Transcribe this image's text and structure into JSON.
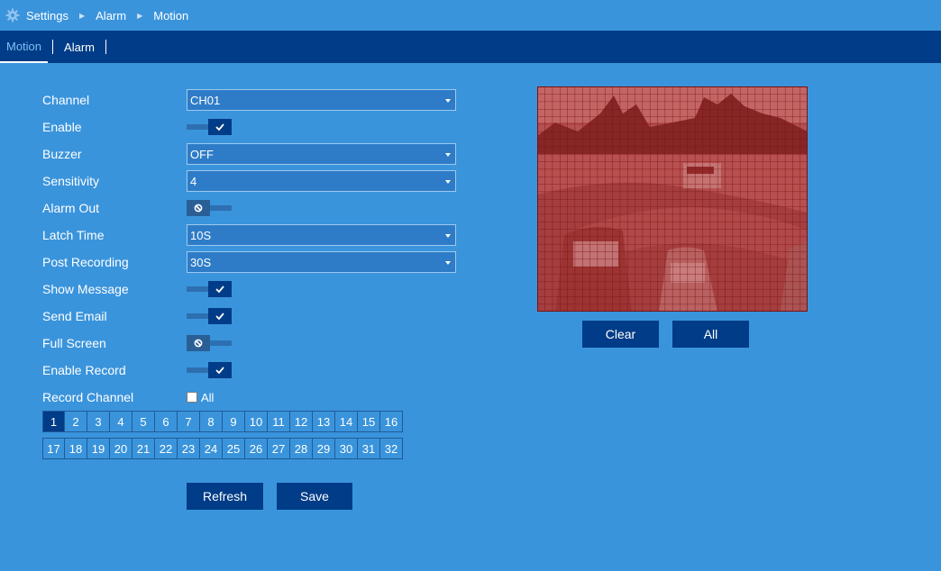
{
  "breadcrumb": [
    "Settings",
    "Alarm",
    "Motion"
  ],
  "tabs": [
    {
      "label": "Motion",
      "active": true
    },
    {
      "label": "Alarm",
      "active": false
    }
  ],
  "fields": {
    "channel": {
      "label": "Channel",
      "value": "CH01"
    },
    "enable": {
      "label": "Enable",
      "on": true
    },
    "buzzer": {
      "label": "Buzzer",
      "value": "OFF"
    },
    "sensitivity": {
      "label": "Sensitivity",
      "value": "4"
    },
    "alarm_out": {
      "label": "Alarm Out",
      "on": false
    },
    "latch_time": {
      "label": "Latch Time",
      "value": "10S"
    },
    "post_recording": {
      "label": "Post Recording",
      "value": "30S"
    },
    "show_message": {
      "label": "Show Message",
      "on": true
    },
    "send_email": {
      "label": "Send Email",
      "on": true
    },
    "full_screen": {
      "label": "Full Screen",
      "on": false
    },
    "enable_record": {
      "label": "Enable Record",
      "on": true
    },
    "record_channel": {
      "label": "Record Channel",
      "all_label": "All",
      "all_checked": false
    }
  },
  "channels_row1": [
    "1",
    "2",
    "3",
    "4",
    "5",
    "6",
    "7",
    "8",
    "9",
    "10",
    "11",
    "12",
    "13",
    "14",
    "15",
    "16"
  ],
  "channels_row2": [
    "17",
    "18",
    "19",
    "20",
    "21",
    "22",
    "23",
    "24",
    "25",
    "26",
    "27",
    "28",
    "29",
    "30",
    "31",
    "32"
  ],
  "selected_channel": "1",
  "buttons": {
    "refresh": "Refresh",
    "save": "Save",
    "clear": "Clear",
    "all": "All"
  },
  "icons": {
    "settings": "gear-icon",
    "breadcrumb_sep": "triangle-right-icon",
    "toggle_on": "checkmark-icon",
    "toggle_off": "prohibited-icon",
    "select": "chevron-down-icon"
  },
  "colors": {
    "background": "#3a94dc",
    "tabbar": "#003c87",
    "active_tab": "#7ec0f5",
    "button": "#003c87",
    "motion_overlay": "#a02020"
  }
}
